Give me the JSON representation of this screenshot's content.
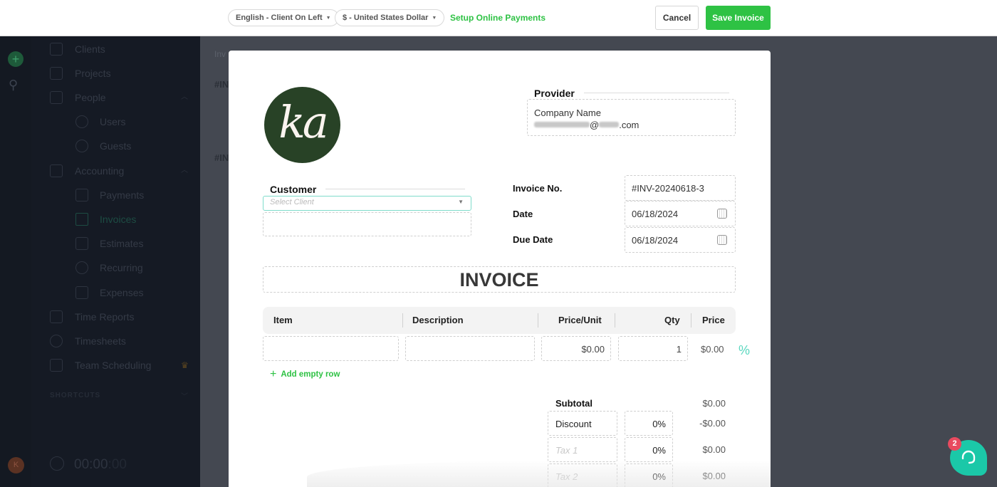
{
  "topbar": {
    "language_select": "English - Client On Left",
    "currency_select": "$ - United States Dollar",
    "setup_payments_link": "Setup Online Payments",
    "cancel_label": "Cancel",
    "save_label": "Save Invoice"
  },
  "sidebar": {
    "items": [
      {
        "label": "Clients",
        "icon": "clients-icon"
      },
      {
        "label": "Projects",
        "icon": "folder-icon"
      },
      {
        "label": "People",
        "icon": "people-icon"
      },
      {
        "label": "Users",
        "icon": "user-icon"
      },
      {
        "label": "Guests",
        "icon": "eye-icon"
      },
      {
        "label": "Accounting",
        "icon": "scale-icon"
      },
      {
        "label": "Payments",
        "icon": "card-icon"
      },
      {
        "label": "Invoices",
        "icon": "invoice-icon"
      },
      {
        "label": "Estimates",
        "icon": "grid-icon"
      },
      {
        "label": "Recurring",
        "icon": "refresh-icon"
      },
      {
        "label": "Expenses",
        "icon": "wallet-icon"
      },
      {
        "label": "Time Reports",
        "icon": "chart-icon"
      },
      {
        "label": "Timesheets",
        "icon": "clock-icon"
      },
      {
        "label": "Team Scheduling",
        "icon": "calendar-check-icon"
      }
    ],
    "shortcuts_label": "SHORTCUTS",
    "timer_main": "00:00",
    "timer_seconds": ":00",
    "avatar_initial": "K"
  },
  "background": {
    "tab_label": "Inv",
    "invoice_prefix_1": "#IN",
    "invoice_prefix_2": "#IN"
  },
  "invoice": {
    "logo_text": "ka",
    "provider_label": "Provider",
    "provider_company": "Company Name",
    "provider_email_suffix": ".com",
    "provider_email_at": "@",
    "customer_label": "Customer",
    "customer_placeholder": "Select Client",
    "invoice_no_label": "Invoice No.",
    "invoice_no": "#INV-20240618-3",
    "date_label": "Date",
    "date": "06/18/2024",
    "due_date_label": "Due Date",
    "due_date": "06/18/2024",
    "title": "INVOICE",
    "columns": [
      "Item",
      "Description",
      "Price/Unit",
      "Qty",
      "Price"
    ],
    "rows": [
      {
        "item": "",
        "description": "",
        "price_unit": "$0.00",
        "qty": "1",
        "price": "$0.00"
      }
    ],
    "add_row_label": "Add empty row",
    "subtotal_label": "Subtotal",
    "subtotal": "$0.00",
    "adjustments": [
      {
        "name": "Discount",
        "placeholder": "",
        "percent": "0%",
        "amount": "-$0.00"
      },
      {
        "name": "",
        "placeholder": "Tax 1",
        "percent": "0%",
        "amount": "$0.00"
      },
      {
        "name": "",
        "placeholder": "Tax 2",
        "percent": "0%",
        "amount": "$0.00"
      }
    ]
  },
  "support": {
    "badge_count": "2"
  },
  "colors": {
    "accent_green": "#2ec244",
    "teal": "#1bc8a8",
    "badge_red": "#e84a5f",
    "logo_green": "#284226"
  }
}
